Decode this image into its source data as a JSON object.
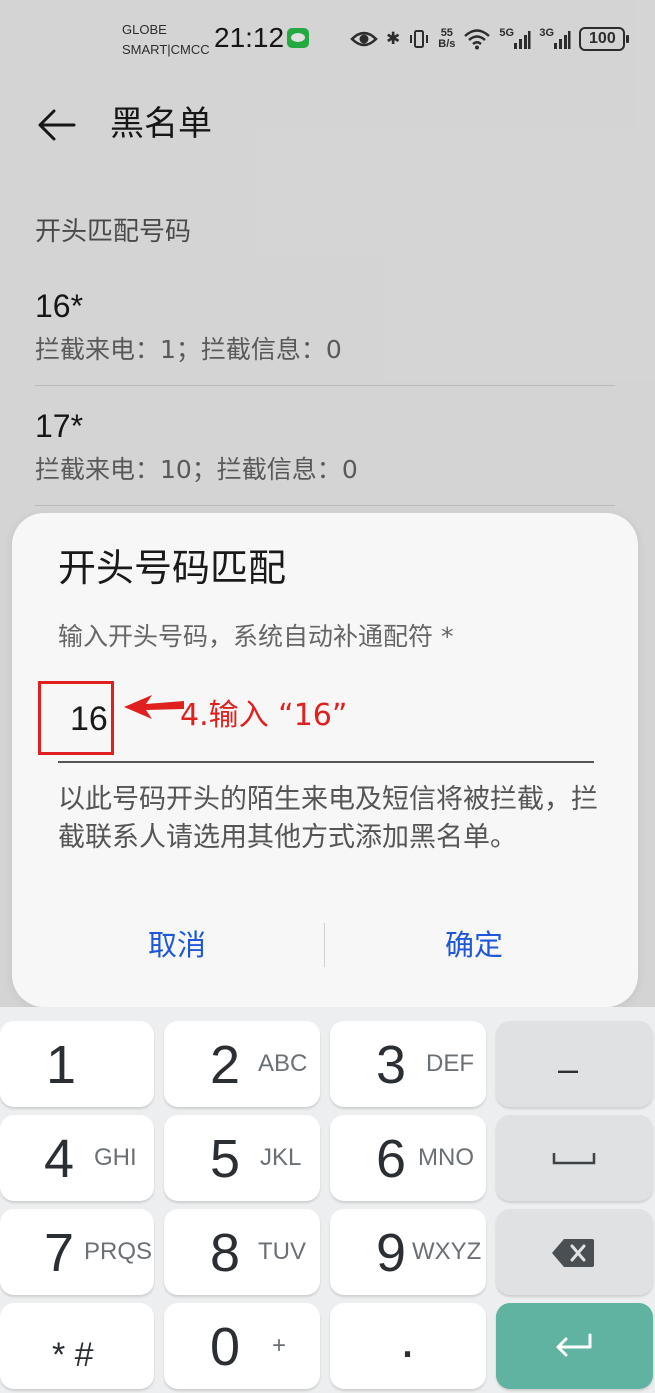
{
  "status_bar": {
    "carrier_line1": "GLOBE",
    "carrier_line2": "SMART|CMCC",
    "time": "21:12",
    "net_speed_top": "55",
    "net_speed_bottom": "B/s",
    "sig1_label": "5G",
    "sig2_label": "3G",
    "battery": "100",
    "icons": [
      "wechat-icon",
      "eye-icon",
      "bluetooth-icon",
      "vibrate-icon",
      "wifi-icon",
      "signal-icon",
      "signal-icon",
      "battery-icon"
    ]
  },
  "header": {
    "title": "黑名单"
  },
  "list": {
    "section_label": "开头匹配号码",
    "items": [
      {
        "number": "16*",
        "info": "拦截来电：1；拦截信息：0"
      },
      {
        "number": "17*",
        "info": "拦截来电：10；拦截信息：0"
      }
    ]
  },
  "dialog": {
    "title": "开头号码匹配",
    "hint": "输入开头号码，系统自动补通配符 *",
    "input_value": "16",
    "annotation": "4.输入 “16”",
    "description": "以此号码开头的陌生来电及短信将被拦截，拦截联系人请选用其他方式添加黑名单。",
    "cancel": "取消",
    "confirm": "确定"
  },
  "keypad": {
    "keys": [
      {
        "digit": "1",
        "letters": ""
      },
      {
        "digit": "2",
        "letters": "ABC"
      },
      {
        "digit": "3",
        "letters": "DEF"
      },
      {
        "digit": "4",
        "letters": "GHI"
      },
      {
        "digit": "5",
        "letters": "JKL"
      },
      {
        "digit": "6",
        "letters": "MNO"
      },
      {
        "digit": "7",
        "letters": "PRQS"
      },
      {
        "digit": "8",
        "letters": "TUV"
      },
      {
        "digit": "9",
        "letters": "WXYZ"
      },
      {
        "digit": "* #",
        "letters": ""
      },
      {
        "digit": "0",
        "letters": "+"
      },
      {
        "digit": ".",
        "letters": ""
      }
    ],
    "minus": "–"
  },
  "colors": {
    "accent": "#1e58d8",
    "annotation": "#e0201e",
    "enter_key": "#5fb3a0"
  }
}
